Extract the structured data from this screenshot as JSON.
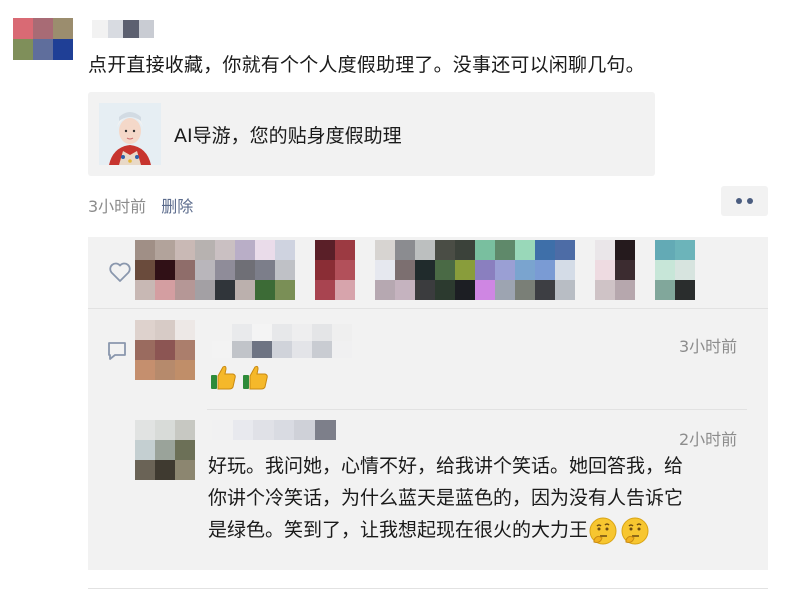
{
  "post": {
    "text": "点开直接收藏，你就有个个人度假助理了。没事还可以闲聊几句。",
    "link_card": {
      "title": "AI导游，您的贴身度假助理"
    },
    "time": "3小时前",
    "delete_label": "删除",
    "more_icon": "more-dots-icon"
  },
  "interactions": {
    "like_icon": "heart-icon",
    "comment_icon": "comment-icon",
    "comments": [
      {
        "time": "3小时前",
        "emoji": "thumbs-up-icon",
        "emoji_count": 2
      },
      {
        "time": "2小时前",
        "lines": [
          "好玩。我问她，心情不好，给我讲个笑话。她回答我，给",
          "你讲个冷笑话，为什么蓝天是蓝色的，因为没有人告诉它",
          "是绿色。笑到了，让我想起现在很火的大力王"
        ],
        "trailing_emoji": "thinking-face-icon",
        "trailing_emoji_count": 2
      }
    ]
  },
  "colors": {
    "link_blue": "#5b6b8c",
    "meta_gray": "#8c8c8c",
    "panel_bg": "#f2f2f2"
  }
}
